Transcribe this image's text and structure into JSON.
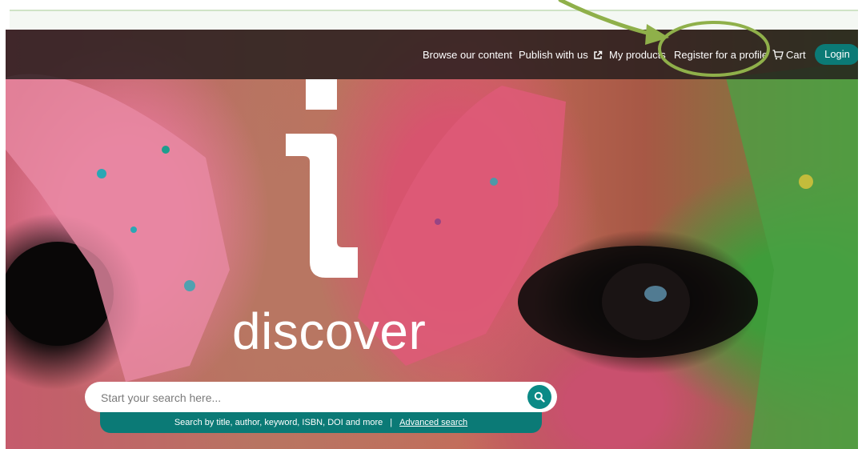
{
  "nav": {
    "items": [
      {
        "label": "Browse our content"
      },
      {
        "label": "Publish with us"
      },
      {
        "label": "My products"
      },
      {
        "label": "Register for a profile"
      }
    ],
    "cart_label": "Cart",
    "login_label": "Login"
  },
  "hero": {
    "logo_word": "discover",
    "search_placeholder": "Start your search here...",
    "help_text": "Search by title, author, keyword, ISBN, DOI and more",
    "help_separator": "|",
    "advanced_search_label": "Advanced search"
  },
  "colors": {
    "brand_teal": "#0b7a76",
    "annotation_green": "#8fb04a",
    "nav_background": "#221c1c"
  },
  "icons": {
    "external": "external-link-icon",
    "cart": "cart-icon",
    "search": "search-icon"
  }
}
